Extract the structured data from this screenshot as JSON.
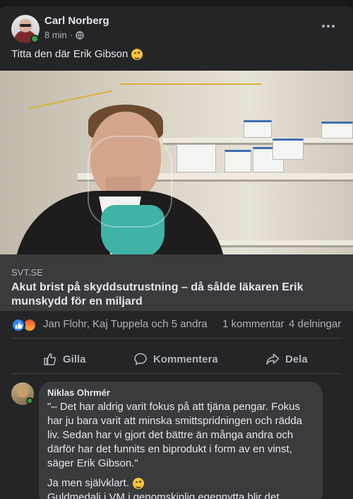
{
  "post": {
    "author": "Carl Norberg",
    "time": "8 min",
    "separator": "·",
    "text": "Titta den där Erik Gibson",
    "text_emoji": "winking-face-emoji"
  },
  "link": {
    "domain": "SVT.SE",
    "title": "Akut brist på skyddsutrustning – då sålde läkaren Erik munskydd för en miljard"
  },
  "stats": {
    "reaction_types": [
      "like",
      "angry"
    ],
    "reactors": "Jan Flohr, Kaj Tuppela och 5 andra",
    "comments": "1 kommentar",
    "shares": "4 delningar"
  },
  "actions": {
    "like": "Gilla",
    "comment": "Kommentera",
    "share": "Dela"
  },
  "comment": {
    "author": "Niklas Ohrmér",
    "paragraph1": "\"– Det har aldrig varit fokus på att tjäna pengar. Fokus har ju bara varit att minska smittspridningen och rädda liv. Sedan har vi gjort det bättre än många andra och därför har det funnits en biprodukt i form av en vinst, säger Erik Gibson.\"",
    "line2": "Ja men självklart.",
    "line3": "Guldmedalj i VM i genomskinlig egennytta blir det."
  },
  "colors": {
    "background": "#18191a",
    "card": "#242526",
    "bubble": "#3a3b3c",
    "text": "#e4e6eb",
    "secondary": "#b0b3b8",
    "like_blue": "#2d88ff",
    "online_green": "#31a24c"
  }
}
